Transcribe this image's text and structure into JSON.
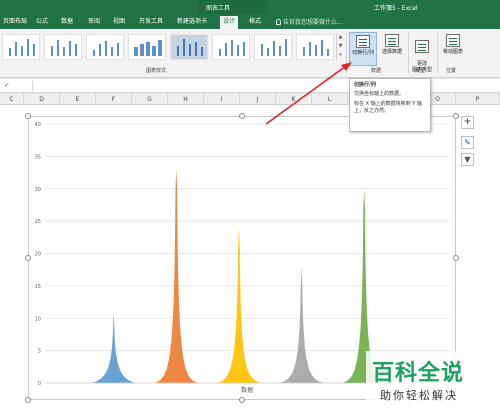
{
  "titlebar": {
    "tools_label": "图表工具",
    "doc_title": "工作簿5 - Excel"
  },
  "tabs": [
    {
      "label": "页面布局",
      "active": false
    },
    {
      "label": "公式",
      "active": false
    },
    {
      "label": "数据",
      "active": false
    },
    {
      "label": "审阅",
      "active": false
    },
    {
      "label": "视图",
      "active": false
    },
    {
      "label": "开发工具",
      "active": false
    },
    {
      "label": "新建选项卡",
      "active": false
    },
    {
      "label": "设计",
      "active": true
    },
    {
      "label": "格式",
      "active": false
    }
  ],
  "tellme": "告诉我您想要做什么...",
  "ribbon": {
    "chart_styles_label": "图表样式",
    "switch_row_col": "切换行/列",
    "select_data": "选择数据",
    "data_group_label": "数据",
    "change_chart_type": "更改\n图表类型",
    "type_group_label": "类型",
    "move_chart": "移动图表",
    "location_group_label": "位置"
  },
  "tooltip": {
    "title": "切换行/列",
    "line1": "交换坐标轴上的数据。",
    "line2": "标在 X 轴上的数据将移到 Y 轴上，反之亦然。"
  },
  "formula_bar": {
    "mark": "✓"
  },
  "column_headers": [
    "C",
    "D",
    "E",
    "F",
    "G",
    "H",
    "I",
    "J",
    "K",
    "L",
    "M",
    "N",
    "O",
    "P"
  ],
  "chart_data": {
    "type": "area",
    "categories": [
      "数据"
    ],
    "xlabel": "数据",
    "ylim": [
      0,
      40
    ],
    "yticks": [
      0,
      5,
      10,
      15,
      20,
      25,
      30,
      35,
      40
    ],
    "grid": true,
    "series": [
      {
        "peak": 11,
        "color": "#5b9bd5"
      },
      {
        "peak": 33,
        "color": "#ed7d31"
      },
      {
        "peak": 24,
        "color": "#ffc000"
      },
      {
        "peak": 18,
        "color": "#a5a5a5"
      },
      {
        "peak": 30,
        "color": "#70ad47"
      }
    ]
  },
  "watermark": {
    "main": "百科全说",
    "sub": "助你轻松解决"
  },
  "colors": {
    "excel_green": "#217346",
    "annotation_red": "#d9262c"
  }
}
